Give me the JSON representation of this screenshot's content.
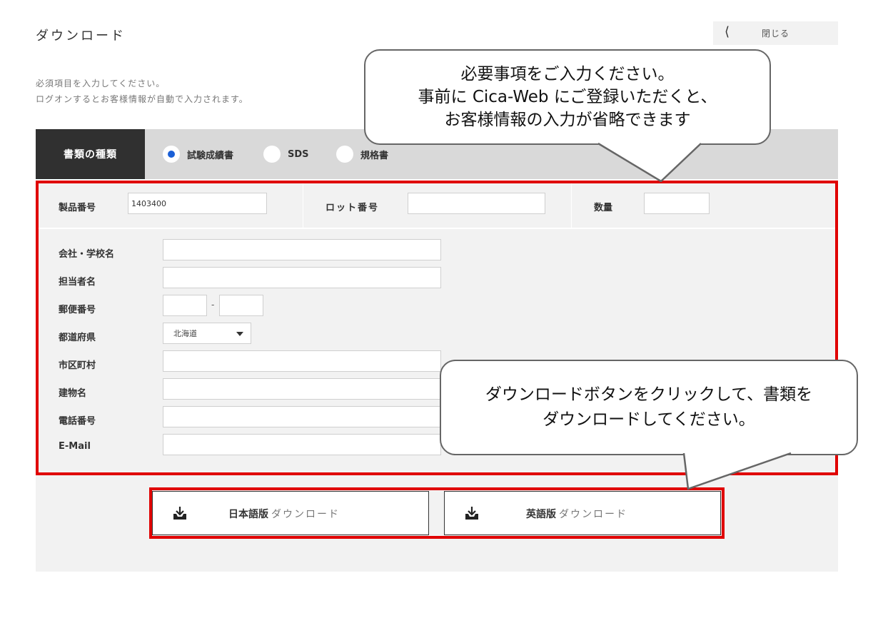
{
  "page": {
    "title": "ダウンロード",
    "close_label": "閉じる",
    "close_icon": "chevron-left-icon"
  },
  "intro": {
    "line1": "必須項目を入力してください。",
    "line2": "ログオンするとお客様情報が自動で入力されます。"
  },
  "doc_type": {
    "label": "書類の種類",
    "options": [
      {
        "label": "試験成績書",
        "selected": true
      },
      {
        "label": "SDS",
        "selected": false
      },
      {
        "label": "規格書",
        "selected": false
      }
    ],
    "selected_color": "#1a5fd6"
  },
  "form": {
    "product_no": {
      "label": "製品番号",
      "value": "1403400"
    },
    "lot_no": {
      "label": "ロット番号",
      "value": ""
    },
    "quantity": {
      "label": "数量",
      "value": ""
    },
    "company": {
      "label": "会社・学校名",
      "value": ""
    },
    "person": {
      "label": "担当者名",
      "value": ""
    },
    "postal": {
      "label": "郵便番号",
      "value1": "",
      "value2": "",
      "separator": "-"
    },
    "prefecture": {
      "label": "都道府県",
      "value": "北海道"
    },
    "city": {
      "label": "市区町村",
      "value": ""
    },
    "building": {
      "label": "建物名",
      "value": ""
    },
    "phone": {
      "label": "電話番号",
      "value": ""
    },
    "email": {
      "label": "E-Mail",
      "value": ""
    }
  },
  "buttons": {
    "jp": {
      "lang": "日本語版",
      "action": "ダウンロード",
      "icon": "download-tray-icon"
    },
    "en": {
      "lang": "英語版",
      "action": "ダウンロード",
      "icon": "download-tray-icon"
    }
  },
  "callouts": {
    "top": {
      "line1": "必要事項をご入力ください。",
      "line2": "事前に Cica-Web にご登録いただくと、",
      "line3": "お客様情報の入力が省略できます"
    },
    "bottom": {
      "line1": "ダウンロードボタンをクリックして、書類を",
      "line2": "ダウンロードしてください。"
    }
  },
  "colors": {
    "highlight_border": "#e00000",
    "dark_label_bg": "#303030",
    "panel_bg": "#f2f2f2"
  }
}
